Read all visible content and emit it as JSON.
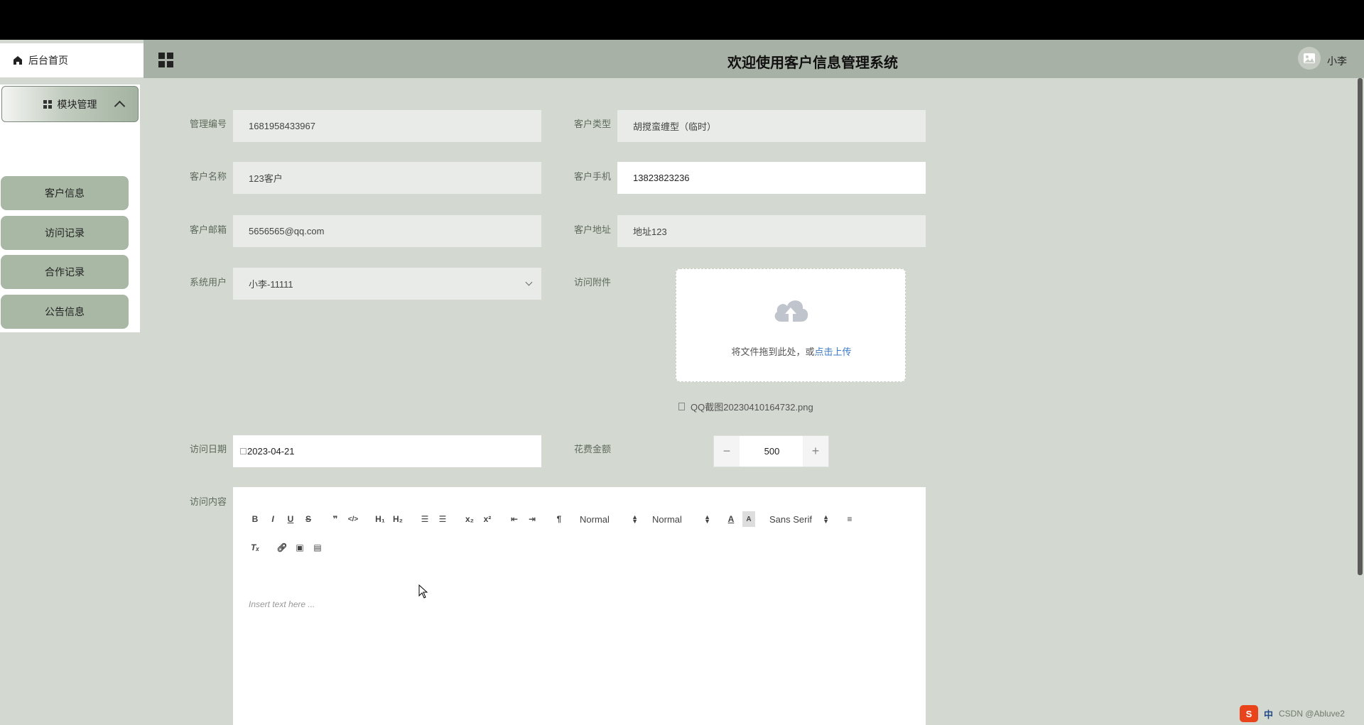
{
  "sidebar": {
    "home_label": "后台首页",
    "module_label": "模块管理",
    "items": [
      {
        "label": "客户信息"
      },
      {
        "label": "访问记录"
      },
      {
        "label": "合作记录"
      },
      {
        "label": "公告信息"
      }
    ]
  },
  "header": {
    "title": "欢迎使用客户信息管理系统",
    "username": "小李"
  },
  "form": {
    "manage_no_label": "管理编号",
    "manage_no_value": "1681958433967",
    "customer_type_label": "客户类型",
    "customer_type_value": "胡搅蛮缠型（临时）",
    "customer_name_label": "客户名称",
    "customer_name_value": "123客户",
    "customer_phone_label": "客户手机",
    "customer_phone_value": "13823823236",
    "customer_email_label": "客户邮箱",
    "customer_email_value": "5656565@qq.com",
    "customer_address_label": "客户地址",
    "customer_address_value": "地址123",
    "system_user_label": "系统用户",
    "system_user_value": "小李-11111",
    "attachment_label": "访问附件",
    "upload_hint": "将文件拖到此处，或",
    "upload_link": "点击上传",
    "file_name": "QQ截图20230410164732.png",
    "visit_date_label": "访问日期",
    "visit_date_value": "2023-04-21",
    "cost_label": "花费金额",
    "cost_value": "500",
    "content_label": "访问内容"
  },
  "editor": {
    "placeholder": "Insert text here ...",
    "header_picker": "Normal",
    "size_picker": "Normal",
    "font_picker": "Sans Serif"
  },
  "tray": {
    "ime_label": "中",
    "watermark": "CSDN @Abluve2"
  },
  "colors": {
    "header_bg": "#a8b1a5",
    "page_bg": "#d3d8d1",
    "menu_item_bg": "#a8b8a5",
    "link": "#3a7ac9"
  }
}
